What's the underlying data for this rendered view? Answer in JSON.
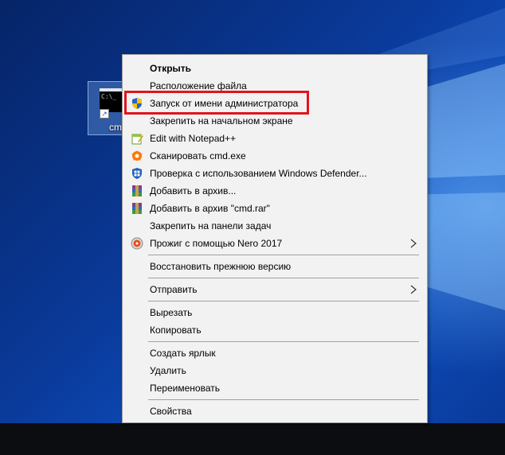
{
  "desktop": {
    "icon_label": "cm",
    "thumb_text": "C:\\_"
  },
  "menu": {
    "items": [
      {
        "label": "Открыть",
        "icon": "none",
        "bold": true
      },
      {
        "label": "Расположение файла",
        "icon": "none"
      },
      {
        "label": "Запуск от имени администратора",
        "icon": "uac-shield-icon"
      },
      {
        "label": "Закрепить на начальном экране",
        "icon": "none"
      },
      {
        "label": "Edit with Notepad++",
        "icon": "notepadpp-icon"
      },
      {
        "label": "Сканировать cmd.exe",
        "icon": "avast-icon"
      },
      {
        "label": "Проверка с использованием Windows Defender...",
        "icon": "windows-defender-icon"
      },
      {
        "label": "Добавить в архив...",
        "icon": "winrar-icon"
      },
      {
        "label": "Добавить в архив \"cmd.rar\"",
        "icon": "winrar-icon"
      },
      {
        "label": "Закрепить на панели задач",
        "icon": "none"
      },
      {
        "label": "Прожиг с помощью Nero 2017",
        "icon": "nero-icon",
        "submenu": true
      },
      {
        "label": "Восстановить прежнюю версию",
        "icon": "none"
      },
      {
        "label": "Отправить",
        "icon": "none",
        "submenu": true
      },
      {
        "label": "Вырезать",
        "icon": "none"
      },
      {
        "label": "Копировать",
        "icon": "none"
      },
      {
        "label": "Создать ярлык",
        "icon": "none"
      },
      {
        "label": "Удалить",
        "icon": "none"
      },
      {
        "label": "Переименовать",
        "icon": "none"
      },
      {
        "label": "Свойства",
        "icon": "none"
      }
    ]
  },
  "colors": {
    "highlight_border": "#e0141e",
    "menu_bg": "#f2f2f2",
    "separator": "#a0a0a0"
  }
}
